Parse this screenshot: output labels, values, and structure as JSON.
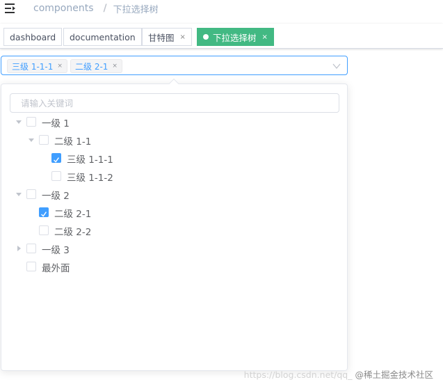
{
  "breadcrumb": {
    "root": "components",
    "separator": "/",
    "current": "下拉选择树"
  },
  "icons": {
    "menu": "hamburger-menu-icon",
    "select_arrow": "chevron-down-icon",
    "expand": "caret-right-icon"
  },
  "tags": [
    {
      "label": "dashboard",
      "closable": false,
      "active": false
    },
    {
      "label": "documentation",
      "closable": false,
      "active": false
    },
    {
      "label": "甘特图",
      "closable": true,
      "active": false
    },
    {
      "label": "下拉选择树",
      "closable": true,
      "active": true
    }
  ],
  "tag_close_glyph": "×",
  "select": {
    "selected": [
      "三级 1-1-1",
      "二级 2-1"
    ],
    "remove_glyph": "×"
  },
  "dropdown": {
    "search_placeholder": "请输入关键词",
    "nodes": [
      {
        "label": "一级 1",
        "level": 0,
        "expander": "expanded",
        "checked": false
      },
      {
        "label": "二级 1-1",
        "level": 1,
        "expander": "expanded",
        "checked": false
      },
      {
        "label": "三级 1-1-1",
        "level": 2,
        "expander": "none",
        "checked": true
      },
      {
        "label": "三级 1-1-2",
        "level": 2,
        "expander": "none",
        "checked": false
      },
      {
        "label": "一级 2",
        "level": 0,
        "expander": "expanded",
        "checked": false
      },
      {
        "label": "二级 2-1",
        "level": 1,
        "expander": "none",
        "checked": true
      },
      {
        "label": "二级 2-2",
        "level": 1,
        "expander": "none",
        "checked": false
      },
      {
        "label": "一级 3",
        "level": 0,
        "expander": "collapsed",
        "checked": false
      },
      {
        "label": "最外面",
        "level": 0,
        "expander": "none",
        "checked": false
      }
    ]
  },
  "watermark": {
    "url": "https://blog.csdn.net/qq_",
    "brand": "@稀土掘金技术社区"
  },
  "colors": {
    "primary": "#409eff",
    "tag_active": "#42b983",
    "border": "#dcdfe6"
  }
}
